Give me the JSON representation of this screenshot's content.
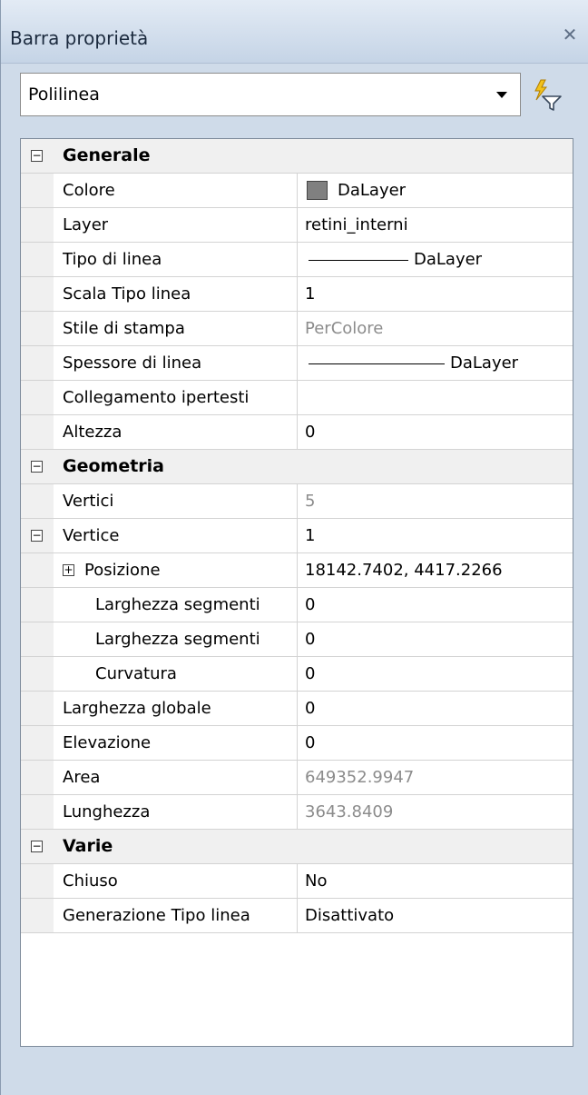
{
  "window": {
    "title": "Barra proprietà",
    "close_glyph": "✕"
  },
  "selector": {
    "value": "Polilinea"
  },
  "quick_select_icon": "quick-select-icon",
  "colors": {
    "swatch": "#808080",
    "readonly_text": "#8c8c8c"
  },
  "sections": {
    "generale": {
      "label": "Generale",
      "rows": {
        "colore": {
          "name": "Colore",
          "value": "DaLayer"
        },
        "layer": {
          "name": "Layer",
          "value": "retini_interni"
        },
        "tipo_linea": {
          "name": "Tipo di linea",
          "value": "DaLayer"
        },
        "scala_tipo": {
          "name": "Scala Tipo linea",
          "value": "1"
        },
        "stile_stampa": {
          "name": "Stile di stampa",
          "value": "PerColore"
        },
        "spessore": {
          "name": "Spessore di linea",
          "value": "DaLayer"
        },
        "collegamento": {
          "name": "Collegamento ipertesti",
          "value": ""
        },
        "altezza": {
          "name": "Altezza",
          "value": "0"
        }
      }
    },
    "geometria": {
      "label": "Geometria",
      "rows": {
        "vertici": {
          "name": "Vertici",
          "value": "5"
        },
        "vertice": {
          "name": "Vertice",
          "value": "1"
        },
        "posizione": {
          "name": "Posizione",
          "value": "18142.7402, 4417.2266"
        },
        "larg_seg_1": {
          "name": "Larghezza segmenti",
          "value": "0"
        },
        "larg_seg_2": {
          "name": "Larghezza segmenti",
          "value": "0"
        },
        "curvatura": {
          "name": "Curvatura",
          "value": "0"
        },
        "larg_globale": {
          "name": "Larghezza globale",
          "value": "0"
        },
        "elevazione": {
          "name": "Elevazione",
          "value": "0"
        },
        "area": {
          "name": "Area",
          "value": "649352.9947"
        },
        "lunghezza": {
          "name": "Lunghezza",
          "value": "3643.8409"
        }
      }
    },
    "varie": {
      "label": "Varie",
      "rows": {
        "chiuso": {
          "name": "Chiuso",
          "value": "No"
        },
        "gen_tipo_linea": {
          "name": "Generazione Tipo linea",
          "value": "Disattivato"
        }
      }
    }
  }
}
